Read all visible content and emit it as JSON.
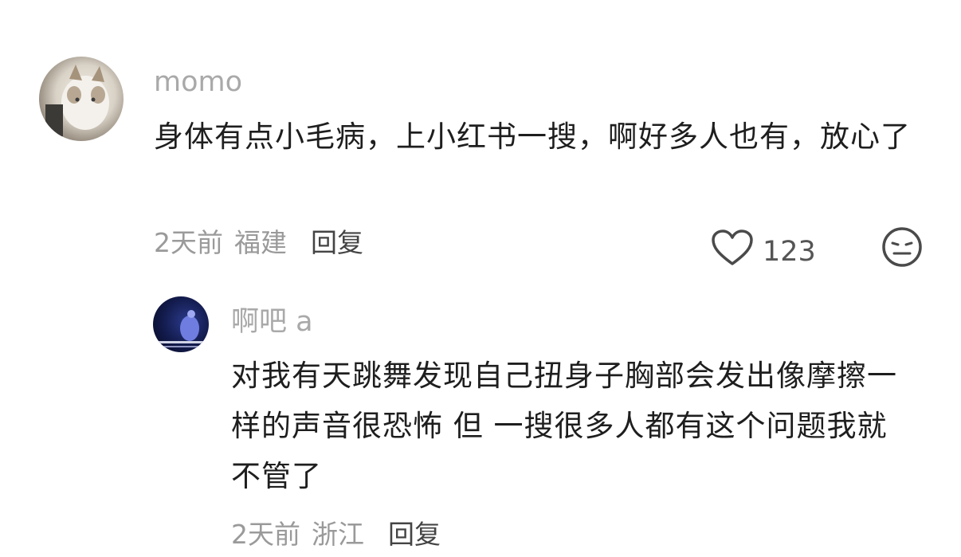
{
  "comment": {
    "username": "momo",
    "text": "身体有点小毛病，上小红书一搜，啊好多人也有，放心了",
    "time": "2天前",
    "location": "福建",
    "reply_label": "回复",
    "like_count": "123"
  },
  "reply": {
    "username": "啊吧 a",
    "text": "对我有天跳舞发现自己扭身子胸部会发出像摩擦一样的声音很恐怖 但 一搜很多人都有这个问题我就不管了",
    "time": "2天前",
    "location": "浙江",
    "reply_label": "回复"
  },
  "icons": [
    "avatar",
    "heart-icon",
    "dislike-face-icon"
  ],
  "colors": {
    "text": "#1e1e1e",
    "meta": "#9a9a9a",
    "username": "#a9a9a9"
  }
}
